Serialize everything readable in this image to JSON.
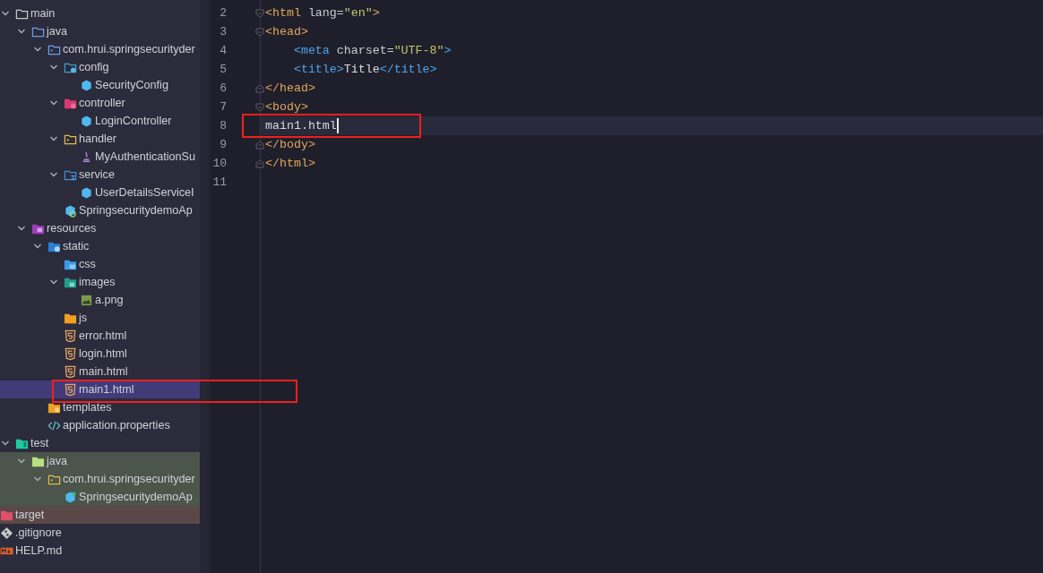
{
  "project_tree": {
    "items": [
      {
        "label": "main",
        "kind": "folder",
        "expanded": true,
        "selected": false,
        "children": [
          {
            "label": "java",
            "kind": "source-folder",
            "expanded": true,
            "selected": false,
            "children": [
              {
                "label": "com.hrui.springsecurityder",
                "kind": "package",
                "expanded": true,
                "selected": false,
                "children": [
                  {
                    "label": "config",
                    "kind": "config-package",
                    "expanded": true,
                    "selected": false,
                    "children": [
                      {
                        "label": "SecurityConfig",
                        "kind": "class",
                        "selected": false
                      }
                    ]
                  },
                  {
                    "label": "controller",
                    "kind": "controller-package",
                    "expanded": true,
                    "selected": false,
                    "children": [
                      {
                        "label": "LoginController",
                        "kind": "class",
                        "selected": false
                      }
                    ]
                  },
                  {
                    "label": "handler",
                    "kind": "handler-package",
                    "expanded": true,
                    "selected": false,
                    "children": [
                      {
                        "label": "MyAuthenticationSu",
                        "kind": "java-file",
                        "selected": false
                      }
                    ]
                  },
                  {
                    "label": "service",
                    "kind": "service-package",
                    "expanded": true,
                    "selected": false,
                    "children": [
                      {
                        "label": "UserDetailsServiceI",
                        "kind": "class",
                        "selected": false
                      }
                    ]
                  },
                  {
                    "label": "SpringsecuritydemoAp",
                    "kind": "app-class",
                    "selected": false
                  }
                ]
              }
            ]
          },
          {
            "label": "resources",
            "kind": "resources-folder",
            "expanded": true,
            "selected": false,
            "children": [
              {
                "label": "static",
                "kind": "web-folder",
                "expanded": true,
                "selected": false,
                "children": [
                  {
                    "label": "css",
                    "kind": "css-folder",
                    "selected": false
                  },
                  {
                    "label": "images",
                    "kind": "images-folder",
                    "expanded": true,
                    "selected": false,
                    "children": [
                      {
                        "label": "a.png",
                        "kind": "image-file",
                        "selected": false
                      }
                    ]
                  },
                  {
                    "label": "js",
                    "kind": "js-folder",
                    "selected": false
                  },
                  {
                    "label": "error.html",
                    "kind": "html-file",
                    "selected": false
                  },
                  {
                    "label": "login.html",
                    "kind": "html-file",
                    "selected": false
                  },
                  {
                    "label": "main.html",
                    "kind": "html-file",
                    "selected": false
                  },
                  {
                    "label": "main1.html",
                    "kind": "html-file",
                    "selected": true,
                    "marked": true
                  }
                ]
              },
              {
                "label": "templates",
                "kind": "templates-folder",
                "selected": false
              },
              {
                "label": "application.properties",
                "kind": "properties-file",
                "selected": false
              }
            ]
          }
        ]
      },
      {
        "label": "test",
        "kind": "test-folder",
        "expanded": true,
        "selected": false,
        "children": [
          {
            "label": "java",
            "kind": "test-source-folder",
            "expanded": true,
            "selected": false,
            "color": "#4b554b",
            "children": [
              {
                "label": "com.hrui.springsecurityder",
                "kind": "test-package",
                "expanded": true,
                "selected": false,
                "color": "#4b554b",
                "children": [
                  {
                    "label": "SpringsecuritydemoAp",
                    "kind": "test-class",
                    "selected": false,
                    "color": "#4b554b"
                  }
                ]
              }
            ]
          }
        ]
      }
    ],
    "root_items": [
      {
        "label": "target",
        "kind": "excluded-folder",
        "selected": false,
        "color": "#5a4848"
      },
      {
        "label": ".gitignore",
        "kind": "git-file",
        "selected": false
      },
      {
        "label": "HELP.md",
        "kind": "markdown-file",
        "selected": false
      }
    ]
  },
  "editor": {
    "lines": [
      {
        "number": "2",
        "kind": "fold-start",
        "tokens": [
          {
            "text": "<html ",
            "kind": "tag"
          },
          {
            "text": "lang=",
            "kind": "attr"
          },
          {
            "text": "\"en\"",
            "kind": "string"
          },
          {
            "text": ">",
            "kind": "tag"
          }
        ]
      },
      {
        "number": "3",
        "kind": "fold-start",
        "tokens": [
          {
            "text": "<head>",
            "kind": "tag"
          }
        ]
      },
      {
        "number": "4",
        "kind": "plain",
        "tokens": [
          {
            "text": "    <meta ",
            "kind": "inner-tag"
          },
          {
            "text": "charset=",
            "kind": "attr"
          },
          {
            "text": "\"UTF-8\"",
            "kind": "string"
          },
          {
            "text": ">",
            "kind": "inner-tag"
          }
        ]
      },
      {
        "number": "5",
        "kind": "plain",
        "tokens": [
          {
            "text": "    <title>",
            "kind": "inner-tag"
          },
          {
            "text": "Title",
            "kind": "text"
          },
          {
            "text": "</title>",
            "kind": "inner-tag"
          }
        ]
      },
      {
        "number": "6",
        "kind": "fold-end",
        "tokens": [
          {
            "text": "</head>",
            "kind": "tag"
          }
        ]
      },
      {
        "number": "7",
        "kind": "fold-start",
        "tokens": [
          {
            "text": "<body>",
            "kind": "tag"
          }
        ]
      },
      {
        "number": "8",
        "kind": "plain",
        "current": true,
        "caret": true,
        "marked": true,
        "tokens": [
          {
            "text": "main1.html",
            "kind": "text"
          }
        ]
      },
      {
        "number": "9",
        "kind": "fold-end",
        "tokens": [
          {
            "text": "</body>",
            "kind": "tag"
          }
        ]
      },
      {
        "number": "10",
        "kind": "fold-end",
        "tokens": [
          {
            "text": "</html>",
            "kind": "tag"
          }
        ]
      },
      {
        "number": "11",
        "kind": "plain"
      }
    ]
  }
}
